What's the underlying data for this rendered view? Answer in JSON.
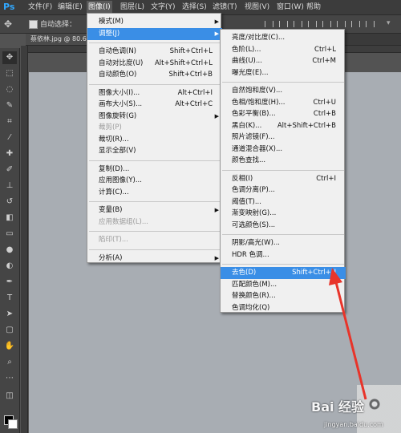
{
  "app": {
    "logo": "Ps",
    "menubar": [
      "文件(F)",
      "编辑(E)",
      "图像(I)",
      "图层(L)",
      "文字(Y)",
      "选择(S)",
      "滤镜(T)",
      "视图(V)",
      "窗口(W)",
      "帮助"
    ],
    "active_menu_index": 2
  },
  "options": {
    "auto_select_label": "自动选择："
  },
  "document": {
    "tab_label": "蔡依林.jpg @ 80.6"
  },
  "image_menu": [
    {
      "label": "模式(M)",
      "shortcut": "",
      "submenu": true,
      "disabled": false
    },
    {
      "label": "调整(J)",
      "shortcut": "",
      "submenu": true,
      "disabled": false,
      "highlight": true
    },
    {
      "sep": true
    },
    {
      "label": "自动色调(N)",
      "shortcut": "Shift+Ctrl+L"
    },
    {
      "label": "自动对比度(U)",
      "shortcut": "Alt+Shift+Ctrl+L"
    },
    {
      "label": "自动颜色(O)",
      "shortcut": "Shift+Ctrl+B"
    },
    {
      "sep": true
    },
    {
      "label": "图像大小(I)...",
      "shortcut": "Alt+Ctrl+I"
    },
    {
      "label": "画布大小(S)...",
      "shortcut": "Alt+Ctrl+C"
    },
    {
      "label": "图像旋转(G)",
      "shortcut": "",
      "submenu": true
    },
    {
      "label": "裁剪(P)",
      "shortcut": "",
      "disabled": true
    },
    {
      "label": "裁切(R)...",
      "shortcut": ""
    },
    {
      "label": "显示全部(V)",
      "shortcut": ""
    },
    {
      "sep": true
    },
    {
      "label": "复制(D)...",
      "shortcut": ""
    },
    {
      "label": "应用图像(Y)...",
      "shortcut": ""
    },
    {
      "label": "计算(C)...",
      "shortcut": ""
    },
    {
      "sep": true
    },
    {
      "label": "变量(B)",
      "shortcut": "",
      "submenu": true
    },
    {
      "label": "应用数据组(L)...",
      "shortcut": "",
      "disabled": true
    },
    {
      "sep": true
    },
    {
      "label": "陷印(T)...",
      "shortcut": "",
      "disabled": true
    },
    {
      "sep": true
    },
    {
      "label": "分析(A)",
      "shortcut": "",
      "submenu": true
    }
  ],
  "adjust_menu": [
    {
      "label": "亮度/对比度(C)...",
      "shortcut": ""
    },
    {
      "label": "色阶(L)...",
      "shortcut": "Ctrl+L"
    },
    {
      "label": "曲线(U)...",
      "shortcut": "Ctrl+M"
    },
    {
      "label": "曝光度(E)...",
      "shortcut": ""
    },
    {
      "sep": true
    },
    {
      "label": "自然饱和度(V)...",
      "shortcut": ""
    },
    {
      "label": "色相/饱和度(H)...",
      "shortcut": "Ctrl+U"
    },
    {
      "label": "色彩平衡(B)...",
      "shortcut": "Ctrl+B"
    },
    {
      "label": "黑白(K)...",
      "shortcut": "Alt+Shift+Ctrl+B"
    },
    {
      "label": "照片滤镜(F)...",
      "shortcut": ""
    },
    {
      "label": "通道混合器(X)...",
      "shortcut": ""
    },
    {
      "label": "颜色查找...",
      "shortcut": ""
    },
    {
      "sep": true
    },
    {
      "label": "反相(I)",
      "shortcut": "Ctrl+I"
    },
    {
      "label": "色调分离(P)...",
      "shortcut": ""
    },
    {
      "label": "阈值(T)...",
      "shortcut": ""
    },
    {
      "label": "渐变映射(G)...",
      "shortcut": ""
    },
    {
      "label": "可选颜色(S)...",
      "shortcut": ""
    },
    {
      "sep": true
    },
    {
      "label": "阴影/高光(W)...",
      "shortcut": ""
    },
    {
      "label": "HDR 色调...",
      "shortcut": ""
    },
    {
      "sep": true
    },
    {
      "label": "去色(D)",
      "shortcut": "Shift+Ctrl+U",
      "highlight": true
    },
    {
      "label": "匹配颜色(M)...",
      "shortcut": ""
    },
    {
      "label": "替换颜色(R)...",
      "shortcut": ""
    },
    {
      "label": "色调均化(Q)",
      "shortcut": ""
    }
  ],
  "colors": {
    "highlight": "#3a8ee6",
    "annotation": "#e8342a",
    "ps_blue": "#31a8ff"
  },
  "watermark": {
    "logo": "Bai 经验",
    "url": "jingyan.baidu.com"
  }
}
